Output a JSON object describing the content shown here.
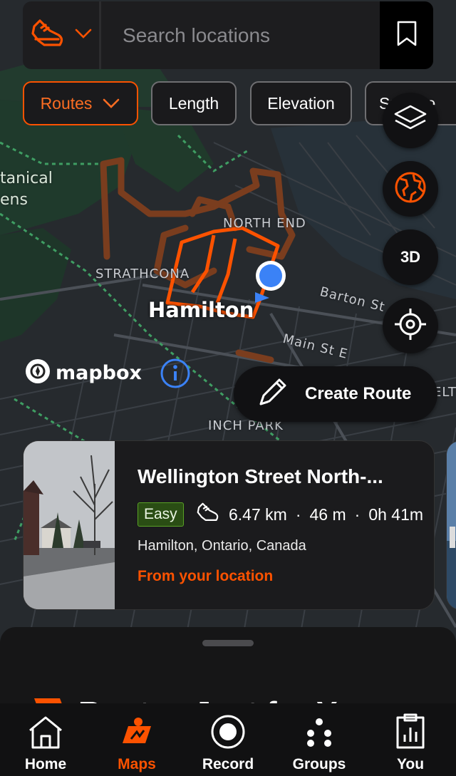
{
  "search": {
    "placeholder": "Search locations"
  },
  "filters": [
    {
      "label": "Routes",
      "active": true
    },
    {
      "label": "Length",
      "active": false
    },
    {
      "label": "Elevation",
      "active": false
    },
    {
      "label": "Surface",
      "active": false
    }
  ],
  "map": {
    "labels": {
      "botanical_1": "tanical",
      "botanical_2": "ens",
      "north_end": "NORTH END",
      "strathcona": "STRATHCONA",
      "city": "Hamilton",
      "barton": "Barton St",
      "main": "Main St E",
      "inch_park": "INCH PARK",
      "edge_elt": "ELT"
    },
    "attribution": "mapbox",
    "three_d_label": "3D",
    "create_route_label": "Create Route"
  },
  "route_card": {
    "title": "Wellington Street North-...",
    "difficulty": "Easy",
    "distance": "6.47 km",
    "elevation": "46 m",
    "duration": "0h 41m",
    "location": "Hamilton, Ontario, Canada",
    "origin": "From your location"
  },
  "sheet": {
    "heading": "Routes Just for You"
  },
  "nav": [
    {
      "label": "Home"
    },
    {
      "label": "Maps"
    },
    {
      "label": "Record"
    },
    {
      "label": "Groups"
    },
    {
      "label": "You"
    }
  ],
  "colors": {
    "accent": "#fc5200",
    "route": "#fc5200",
    "route_muted": "#8a4420",
    "easy_badge": "#2a4d14",
    "location_dot": "#3b82f6"
  }
}
